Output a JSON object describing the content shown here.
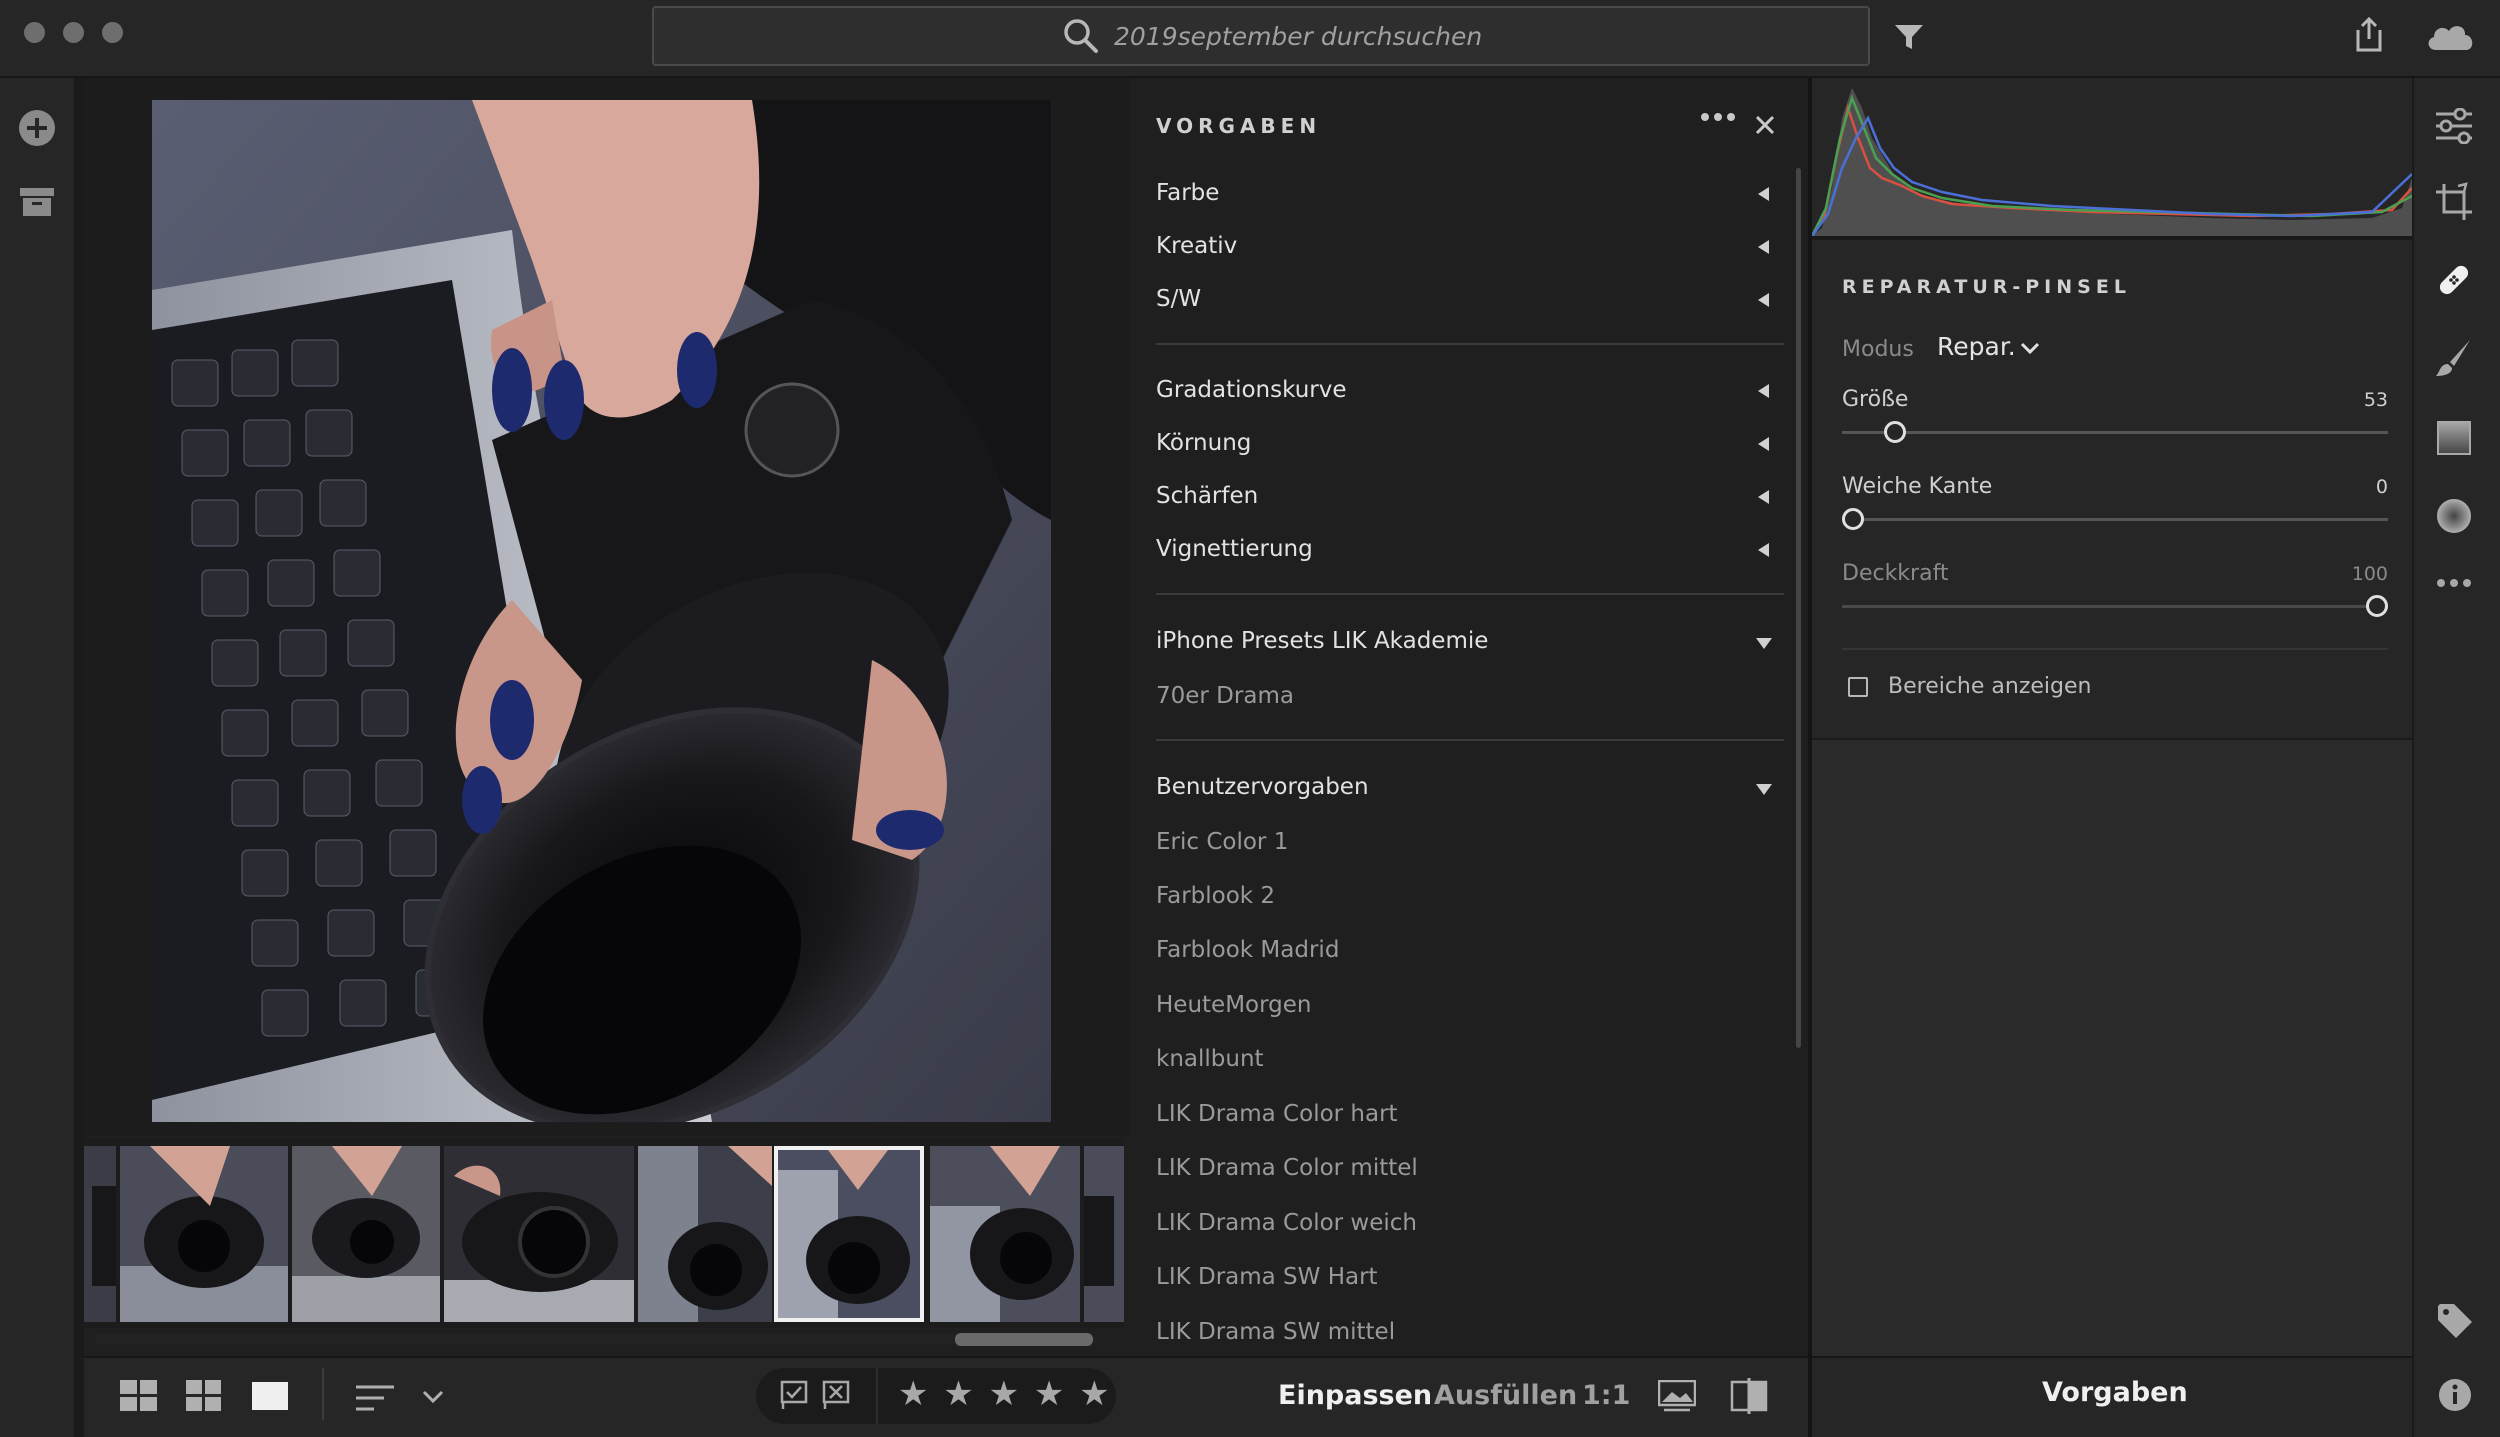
{
  "search": {
    "placeholder": "2019september durchsuchen"
  },
  "presets": {
    "title": "VORGABEN",
    "group1": [
      "Farbe",
      "Kreativ",
      "S/W"
    ],
    "group2": [
      "Gradationskurve",
      "Körnung",
      "Schärfen",
      "Vignettierung"
    ],
    "iphone": {
      "title": "iPhone Presets LIK Akademie",
      "items": [
        "70er Drama"
      ]
    },
    "user": {
      "title": "Benutzervorgaben",
      "items": [
        "Eric Color 1",
        "Farblook 2",
        "Farblook Madrid",
        "HeuteMorgen",
        "knallbunt",
        "LIK Drama Color hart",
        "LIK Drama Color mittel",
        "LIK Drama Color weich",
        "LIK Drama SW Hart",
        "LIK Drama SW mittel"
      ]
    }
  },
  "healing": {
    "title": "REPARATUR-PINSEL",
    "mode_label": "Modus",
    "mode_value": "Repar.",
    "size_label": "Größe",
    "size_value": "53",
    "size_level": 0.08,
    "feather_label": "Weiche Kante",
    "feather_value": "0",
    "feather_level": 0.0,
    "opacity_label": "Deckkraft",
    "opacity_value": "100",
    "opacity_level": 1.0,
    "show_areas_label": "Bereiche anzeigen"
  },
  "bottombar": {
    "fit": "Einpassen",
    "fill": "Ausfüllen",
    "one_to_one": "1:1",
    "rating_stars": "★ ★ ★ ★ ★"
  },
  "footer": {
    "presets_button": "Vorgaben"
  }
}
